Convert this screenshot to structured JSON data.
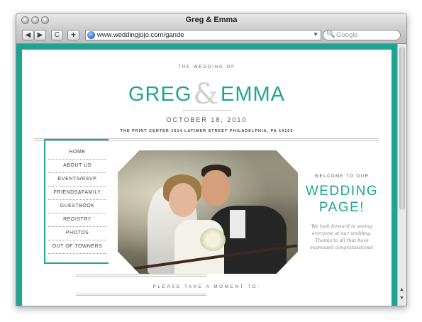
{
  "window": {
    "title": "Greg & Emma"
  },
  "toolbar": {
    "back_icon": "back-arrow",
    "forward_icon": "forward-arrow",
    "reload_symbol": "C",
    "add_symbol": "+",
    "url": "www.weddingjojo.com/gande",
    "search_placeholder": "Google"
  },
  "site": {
    "accent_color": "#1ea591",
    "pre_title": "THE WEDDING OF",
    "name_left": "GREG",
    "ampersand": "&",
    "name_right": "EMMA",
    "date": "OCTOBER 18, 2010",
    "venue": "THE PRINT CENTER  1614 LATIMER STREET  PHILADELPHIA, PA 19103",
    "nav": [
      "HOME",
      "ABOUT US",
      "EVENTS/RSVP",
      "FRIENDS&FAMILY",
      "GUESTBOOK",
      "REGISTRY",
      "PHOTOS",
      "OUT OF TOWNERS"
    ],
    "welcome_small": "WELCOME TO OUR",
    "welcome_line1": "WEDDING",
    "welcome_line2": "PAGE!",
    "welcome_text": "We look forward to seeing everyone at our wedding. Thanks to all that have expressed congratulations!",
    "moment": "PLEASE TAKE A MOMENT TO:"
  }
}
